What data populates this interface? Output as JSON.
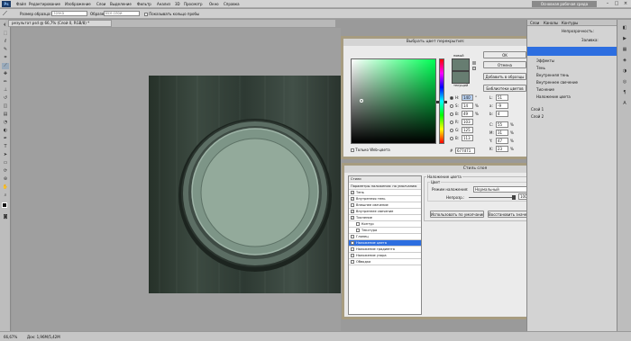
{
  "app": {
    "logo": "Ps",
    "workspace": "Основная рабочая среда"
  },
  "menu": [
    "Файл",
    "Редактирование",
    "Изображение",
    "Слои",
    "Выделение",
    "Фильтр",
    "Анализ",
    "3D",
    "Просмотр",
    "Окно",
    "Справка"
  ],
  "options": {
    "label1": "Размер образца:",
    "sample_size": "Точка",
    "label2": "Образец:",
    "sample": "Все слои",
    "show_ring": "Показывать кольцо пробы"
  },
  "document_tab": "результат.psd @ 66,7% (Слой 0, RGB/8) *",
  "status": {
    "zoom": "66,67%",
    "doc": "Док: 1,96М/5,42М"
  },
  "color_picker": {
    "title": "Выбрать цвет перекрытия:",
    "new_label": "новый",
    "current_label": "текущий",
    "buttons": {
      "ok": "OK",
      "cancel": "Отмена",
      "add_swatch": "Добавить в образцы",
      "libraries": "Библиотеки цветов"
    },
    "web_only": "Только Web-цвета",
    "fields": [
      {
        "label": "H:",
        "value": "140",
        "unit": "°",
        "selected": true
      },
      {
        "label": "S:",
        "value": "14",
        "unit": "%",
        "selected": false
      },
      {
        "label": "B:",
        "value": "49",
        "unit": "%",
        "selected": false
      },
      {
        "label": "R:",
        "value": "103",
        "unit": "",
        "selected": false
      },
      {
        "label": "G:",
        "value": "125",
        "unit": "",
        "selected": false
      },
      {
        "label": "B:",
        "value": "113",
        "unit": "",
        "selected": false
      }
    ],
    "lab": [
      {
        "label": "L:",
        "value": "51"
      },
      {
        "label": "a:",
        "value": "-9"
      },
      {
        "label": "b:",
        "value": "4"
      }
    ],
    "cmyk": [
      {
        "label": "C:",
        "value": "55",
        "unit": "%"
      },
      {
        "label": "M:",
        "value": "31",
        "unit": "%"
      },
      {
        "label": "Y:",
        "value": "47",
        "unit": "%"
      },
      {
        "label": "K:",
        "value": "23",
        "unit": "%"
      }
    ],
    "hex": "677d71",
    "color": "#677d71"
  },
  "layer_style": {
    "title": "Стиль слоя",
    "list": [
      {
        "label": "Стили",
        "checkbox": false,
        "checked": false,
        "active": false
      },
      {
        "label": "Параметры наложения: по умолчанию",
        "checkbox": false,
        "checked": false,
        "active": false
      },
      {
        "label": "Тень",
        "checkbox": true,
        "checked": true,
        "active": false
      },
      {
        "label": "Внутренняя тень",
        "checkbox": true,
        "checked": true,
        "active": false
      },
      {
        "label": "Внешнее свечение",
        "checkbox": true,
        "checked": false,
        "active": false
      },
      {
        "label": "Внутреннее свечение",
        "checkbox": true,
        "checked": true,
        "active": false
      },
      {
        "label": "Тиснение",
        "checkbox": true,
        "checked": true,
        "active": false
      },
      {
        "label": "Контур",
        "checkbox": true,
        "checked": false,
        "active": false
      },
      {
        "label": "Текстура",
        "checkbox": true,
        "checked": false,
        "active": false
      },
      {
        "label": "Глянец",
        "checkbox": true,
        "checked": false,
        "active": false
      },
      {
        "label": "Наложение цвета",
        "checkbox": true,
        "checked": true,
        "active": true
      },
      {
        "label": "Наложение градиента",
        "checkbox": true,
        "checked": false,
        "active": false
      },
      {
        "label": "Наложение узора",
        "checkbox": true,
        "checked": false,
        "active": false
      },
      {
        "label": "Обводка",
        "checkbox": true,
        "checked": false,
        "active": false
      }
    ],
    "section_title": "Наложение цвета",
    "group_title": "Цвет",
    "blend_label": "Режим наложения:",
    "blend_mode": "Нормальный",
    "opacity_label": "Непрозр.:",
    "opacity_value": "100",
    "opacity_unit": "%",
    "btn_default": "Использовать по умолчанию",
    "btn_restore": "Восстановить значения по умолчанию",
    "buttons": {
      "ok": "OK",
      "cancel": "Отмена",
      "new_style": "Новый стиль...",
      "preview": "Просмотр"
    }
  },
  "right_panel": {
    "tabs": [
      "Слои",
      "Каналы",
      "Контуры"
    ],
    "mode": "Непрозрачность:",
    "fill": "Заливка:",
    "items": [
      "Эффекты",
      "Тень",
      "Внутренняя тень",
      "Внутреннее свечение",
      "Тиснение",
      "Наложение цвета",
      "Слой 1",
      "Слой 2"
    ]
  }
}
